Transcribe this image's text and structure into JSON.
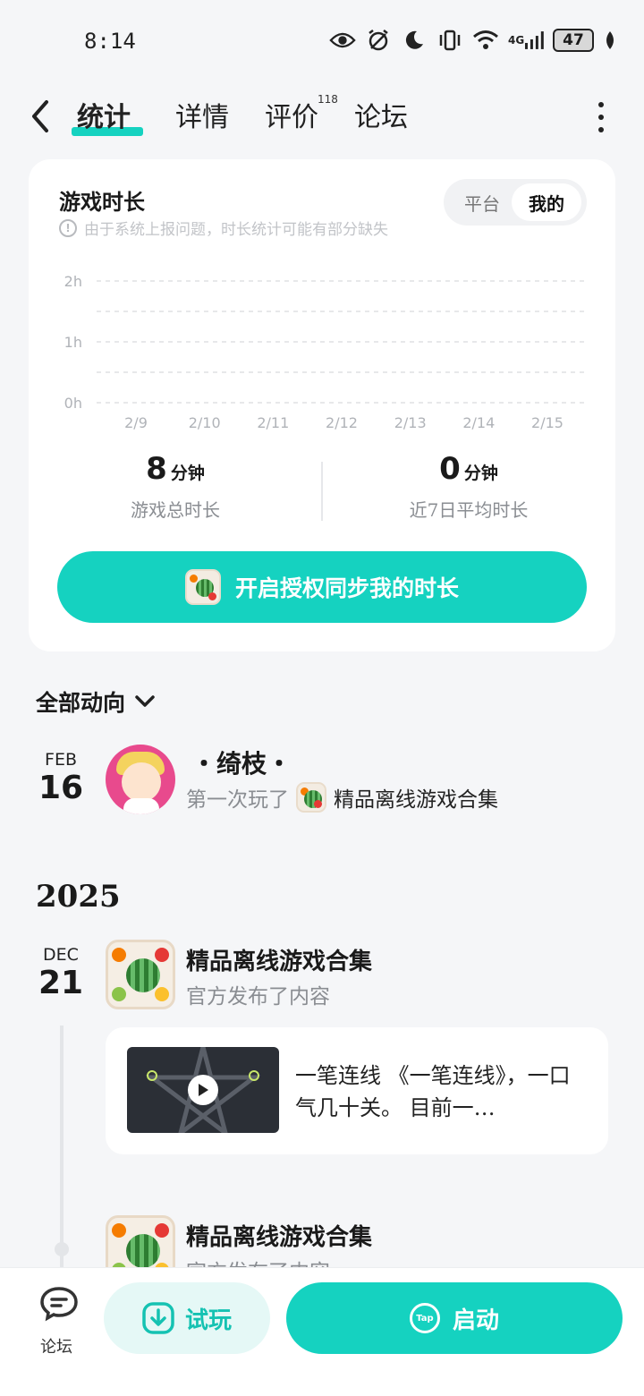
{
  "status_bar": {
    "time": "8:14",
    "network": "4G",
    "battery": "47",
    "icons": [
      "eye-icon",
      "alarm-icon",
      "moon-icon",
      "vibrate-icon",
      "wifi-icon",
      "signal-icon",
      "battery-icon",
      "leaf-icon"
    ]
  },
  "header": {
    "tabs": [
      {
        "label": "统计",
        "active": true
      },
      {
        "label": "详情",
        "active": false
      },
      {
        "label": "评价",
        "active": false
      },
      {
        "label": "论坛",
        "active": false
      }
    ],
    "review_count": "118"
  },
  "stats_card": {
    "title": "游戏时长",
    "note": "由于系统上报问题，时长统计可能有部分缺失",
    "toggle": {
      "platform": "平台",
      "mine": "我的",
      "selected": "我的"
    },
    "summary": {
      "total_value": "8",
      "total_unit": "分钟",
      "total_label": "游戏总时长",
      "avg_value": "0",
      "avg_unit": "分钟",
      "avg_label": "近7日平均时长"
    },
    "sync_button": "开启授权同步我的时长"
  },
  "chart_data": {
    "type": "bar",
    "categories": [
      "2/9",
      "2/10",
      "2/11",
      "2/12",
      "2/13",
      "2/14",
      "2/15"
    ],
    "values": [
      0,
      0,
      0,
      0,
      0,
      0,
      0
    ],
    "y_ticks": [
      "2h",
      "1h",
      "0h"
    ],
    "ylim": [
      0,
      2
    ],
    "grid": true,
    "title": "",
    "xlabel": "",
    "ylabel": ""
  },
  "activity": {
    "filter_label": "全部动向",
    "entries": [
      {
        "month": "FEB",
        "day": "16",
        "user": "・绮枝・",
        "action": "第一次玩了",
        "game": "精品离线游戏合集"
      }
    ],
    "year": "2025",
    "posts": [
      {
        "month": "DEC",
        "day": "21",
        "title": "精品离线游戏合集",
        "subtitle": "官方发布了内容",
        "content": "一笔连线 《一笔连线》，一口气几十关。 目前一…"
      },
      {
        "title": "精品离线游戏合集",
        "subtitle": "官方发布了内容"
      }
    ]
  },
  "bottom_bar": {
    "forum_label": "论坛",
    "trial_label": "试玩",
    "launch_label": "启动",
    "tap_logo": "Tap"
  },
  "colors": {
    "accent": "#15d2c0",
    "background": "#f5f6f8"
  }
}
